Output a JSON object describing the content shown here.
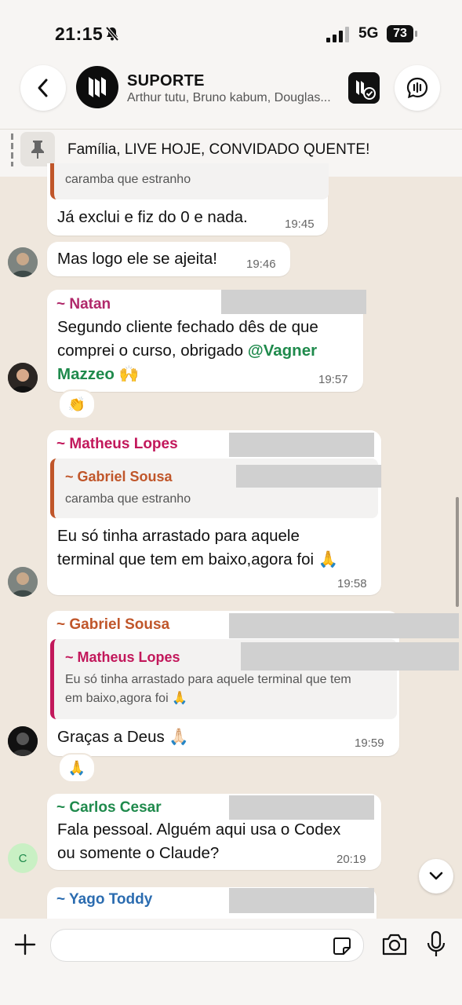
{
  "status_bar": {
    "time": "21:15",
    "network": "5G",
    "battery": "73"
  },
  "header": {
    "group_name": "SUPORTE",
    "members": "Arthur tutu, Bruno kabum, Douglas..."
  },
  "pinned": {
    "text": "Família, LIVE HOJE, CONVIDADO QUENTE!"
  },
  "messages": {
    "m1": {
      "quote_text": "caramba que estranho",
      "text": "Já exclui e fiz do 0 e  nada.",
      "time": "19:45"
    },
    "m2": {
      "text": "Mas logo ele se ajeita!",
      "time": "19:46"
    },
    "m3": {
      "sender": "~ Natan",
      "text_a": "Segundo cliente fechado dês de que",
      "text_b": "comprei o curso, obrigado ",
      "mention_a": "@Vagner",
      "mention_b": "Mazzeo",
      "text_c": " 🙌",
      "time": "19:57",
      "reaction": "👏"
    },
    "m4": {
      "sender": "~ Matheus Lopes",
      "quote_sender": "~ Gabriel Sousa",
      "quote_text": "caramba que estranho",
      "text_a": "Eu só tinha arrastado para aquele",
      "text_b": "terminal que tem em baixo,agora foi 🙏",
      "time": "19:58"
    },
    "m5": {
      "sender": "~ Gabriel Sousa",
      "quote_sender": "~ Matheus Lopes",
      "quote_text_a": "Eu só tinha arrastado para aquele terminal que tem",
      "quote_text_b": "em baixo,agora foi 🙏",
      "text": "Graças a Deus 🙏🏻",
      "time": "19:59",
      "reaction": "🙏"
    },
    "m6": {
      "sender": "~ Carlos Cesar",
      "text_a": "Fala pessoal. Alguém aqui usa o Codex",
      "text_b": "ou somente o Claude?",
      "time": "20:19",
      "avatar_letter": "C"
    },
    "m7": {
      "sender": "~ Yago Toddy"
    }
  },
  "colors": {
    "natan": "#b0286a",
    "matheus": "#c2185b",
    "gabriel": "#c0562a",
    "carlos": "#1f8a4c",
    "yago": "#2b6cb0",
    "mention": "#1f8a4c",
    "chat_background": "#efe7dd"
  }
}
